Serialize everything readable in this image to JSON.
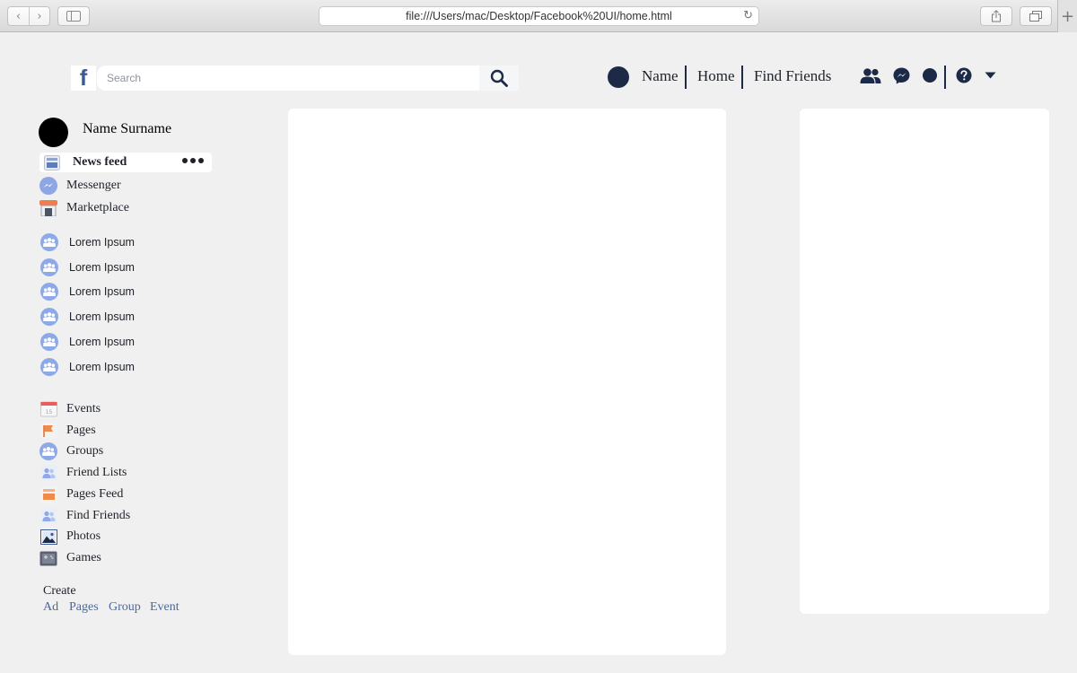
{
  "browser": {
    "url": "file:///Users/mac/Desktop/Facebook%20UI/home.html"
  },
  "header": {
    "logo_letter": "f",
    "search_placeholder": "Search",
    "nav_links": {
      "name": "Name",
      "home": "Home",
      "find_friends": "Find Friends"
    }
  },
  "profile": {
    "name": "Name Surname"
  },
  "sidebar": {
    "primary": [
      {
        "label": "News feed",
        "icon": "news-feed-icon"
      },
      {
        "label": "Messenger",
        "icon": "messenger-icon"
      },
      {
        "label": "Marketplace",
        "icon": "marketplace-icon"
      }
    ],
    "groups": [
      {
        "label": "Lorem Ipsum"
      },
      {
        "label": "Lorem Ipsum"
      },
      {
        "label": "Lorem Ipsum"
      },
      {
        "label": "Lorem Ipsum"
      },
      {
        "label": "Lorem Ipsum"
      },
      {
        "label": "Lorem Ipsum"
      }
    ],
    "explore": [
      {
        "label": "Events",
        "icon": "events-icon"
      },
      {
        "label": "Pages",
        "icon": "pages-flag-icon"
      },
      {
        "label": "Groups",
        "icon": "groups-icon"
      },
      {
        "label": "Friend Lists",
        "icon": "friend-lists-icon"
      },
      {
        "label": "Pages Feed",
        "icon": "pages-feed-icon"
      },
      {
        "label": "Find Friends",
        "icon": "find-friends-icon"
      },
      {
        "label": "Photos",
        "icon": "photos-icon"
      },
      {
        "label": "Games",
        "icon": "games-icon"
      }
    ]
  },
  "create": {
    "title": "Create",
    "links": [
      "Ad",
      "Pages",
      "Group",
      "Event"
    ]
  },
  "colors": {
    "brand": "#3b5998",
    "nav_dark": "#1c2a48",
    "link": "#4b67a1",
    "background": "#f0f0f0"
  }
}
